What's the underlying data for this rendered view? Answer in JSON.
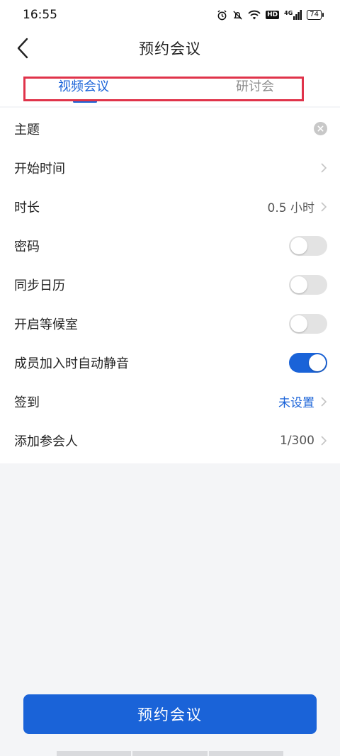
{
  "status_bar": {
    "time": "16:55",
    "icons": [
      "alarm-icon",
      "mute-icon",
      "wifi-icon",
      "hd-icon",
      "4g-signal-icon",
      "battery-icon"
    ],
    "hd_label": "HD",
    "network_label": "4G",
    "battery": "74"
  },
  "header": {
    "title": "预约会议",
    "back_icon": "chevron-left-icon"
  },
  "tabs": [
    {
      "label": "视频会议",
      "active": true
    },
    {
      "label": "研讨会",
      "active": false
    }
  ],
  "form": {
    "rows": [
      {
        "label": "主题",
        "control": "clear-button"
      },
      {
        "label": "开始时间",
        "value": "",
        "control": "chevron"
      },
      {
        "label": "时长",
        "value": "0.5 小时",
        "control": "chevron"
      },
      {
        "label": "密码",
        "control": "toggle",
        "on": false
      },
      {
        "label": "同步日历",
        "control": "toggle",
        "on": false
      },
      {
        "label": "开启等候室",
        "control": "toggle",
        "on": false
      },
      {
        "label": "成员加入时自动静音",
        "control": "toggle",
        "on": true
      },
      {
        "label": "签到",
        "value": "未设置",
        "control": "chevron"
      },
      {
        "label": "添加参会人",
        "value": "1/300",
        "control": "chevron"
      }
    ]
  },
  "submit_label": "预约会议",
  "colors": {
    "accent": "#1a63d8",
    "highlight_box": "#e0334a",
    "background": "#f4f5f7"
  }
}
